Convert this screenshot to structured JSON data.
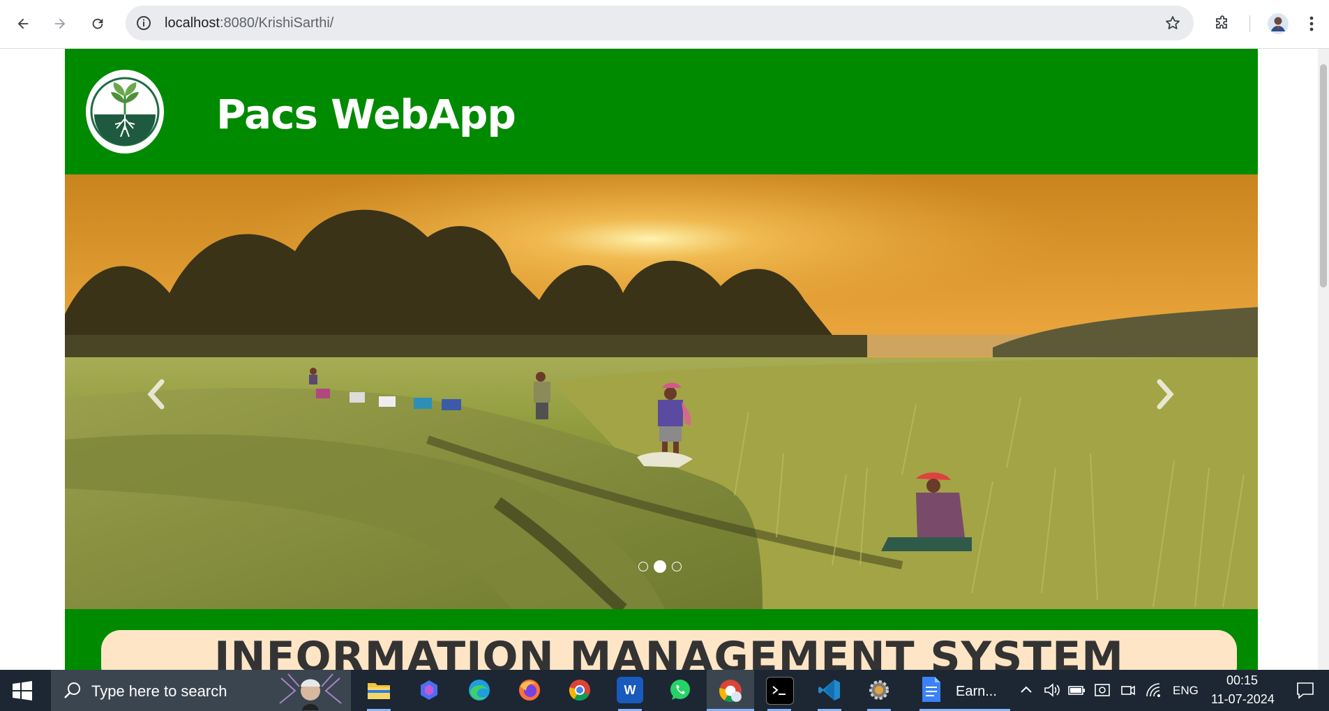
{
  "browser": {
    "url_host": "localhost",
    "url_path": ":8080/KrishiSarthi/"
  },
  "site": {
    "title": "Pacs WebApp",
    "carousel": {
      "slide_count": 3,
      "active_index": 1
    },
    "banner_text": "INFORMATION MANAGEMENT SYSTEM"
  },
  "taskbar": {
    "search_placeholder": "Type here to search",
    "pinned_app_label": "Earn...",
    "tray": {
      "language": "ENG",
      "time": "00:15",
      "date": "11-07-2024"
    }
  },
  "colors": {
    "header_green": "#008a00",
    "banner_pill": "#fde5c6"
  }
}
